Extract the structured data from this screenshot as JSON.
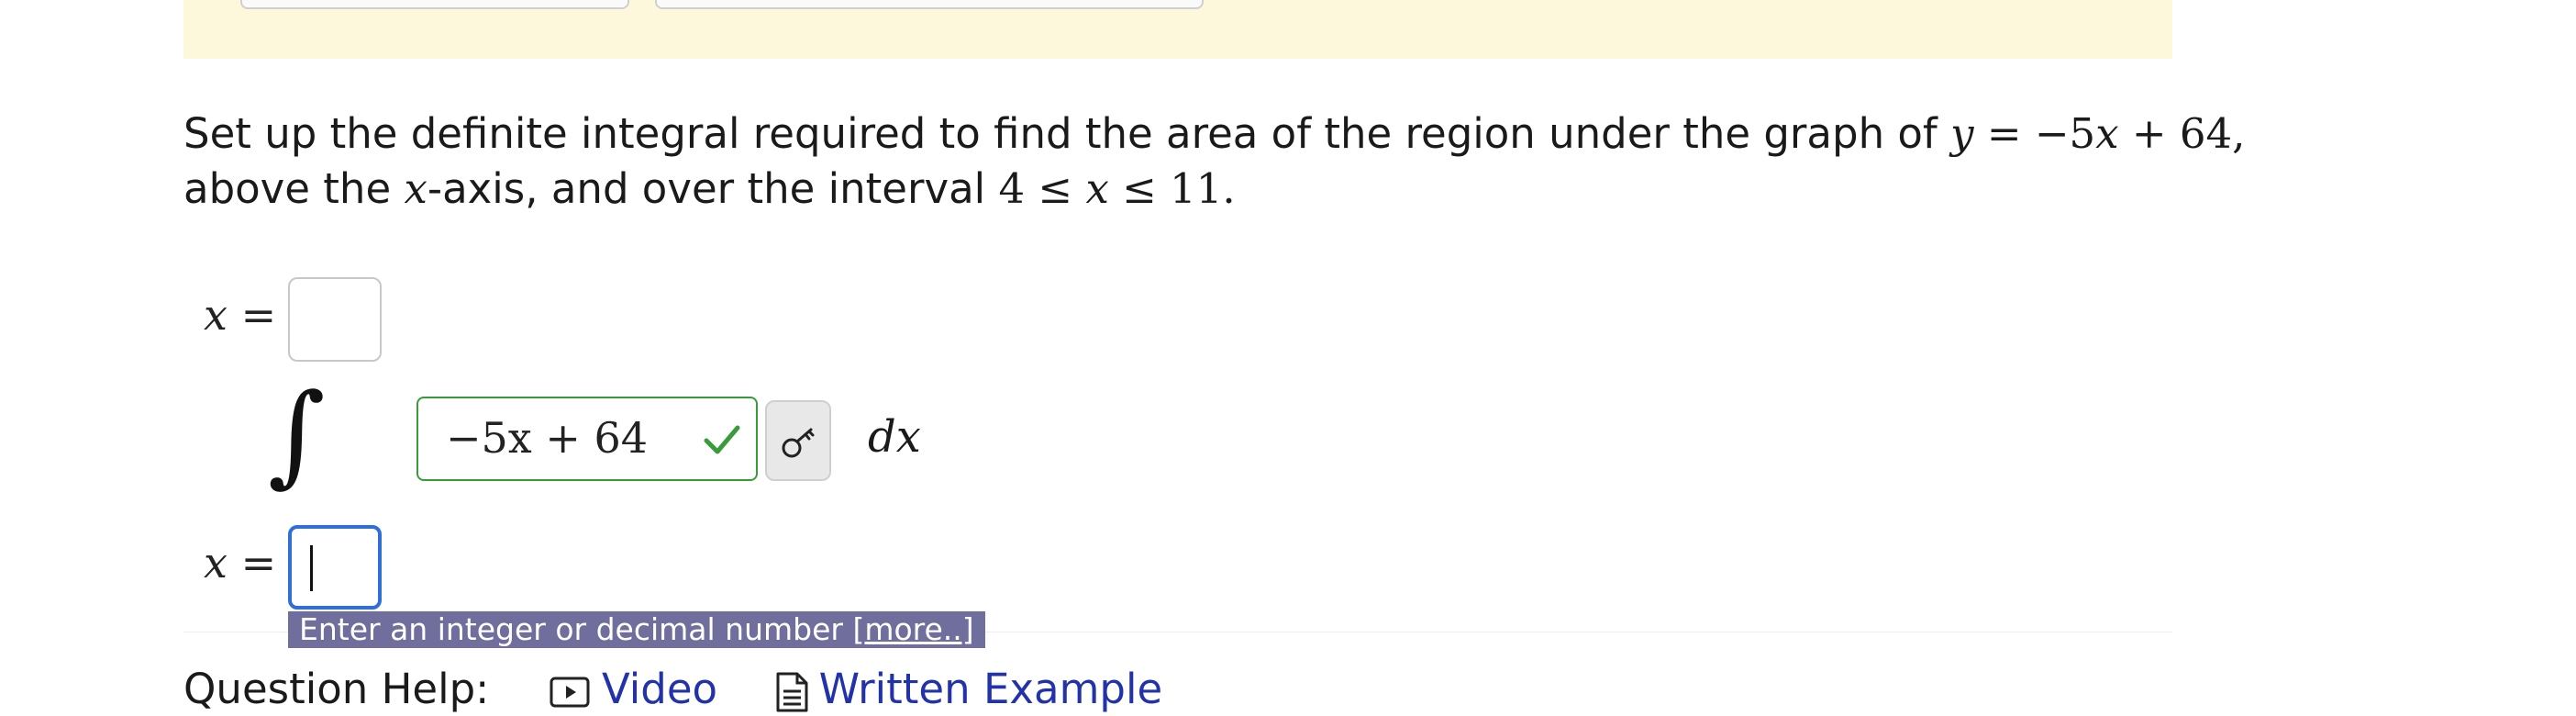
{
  "question": {
    "text_before": "Set up the definite integral required to find the area of the region under the graph of ",
    "function_y": "y",
    "function_eq": " = −5",
    "function_x": "x",
    "function_rest": " + 64,",
    "line2_before": "above the ",
    "line2_x": "x",
    "line2_after": "-axis, and over the interval ",
    "interval_low": "4 ≤ ",
    "interval_x": "x",
    "interval_high": " ≤ 11."
  },
  "integral": {
    "var": "x",
    "equals": " =",
    "symbol": "∫",
    "integrand_value": "−5x + 64",
    "differential": "dx"
  },
  "tooltip": {
    "text": "Enter an integer or decimal number ",
    "more": "[more..]"
  },
  "help": {
    "label": "Question Help:",
    "video": "Video",
    "written_example": "Written Example"
  },
  "icons": {
    "check": "checkmark-icon",
    "key": "key-icon",
    "video": "play-video-icon",
    "document": "document-icon"
  },
  "colors": {
    "banner": "#fdf8dc",
    "correct": "#3b9b3b",
    "focus": "#2f6fd6",
    "tooltip": "#706e9c",
    "link": "#2233aa"
  }
}
